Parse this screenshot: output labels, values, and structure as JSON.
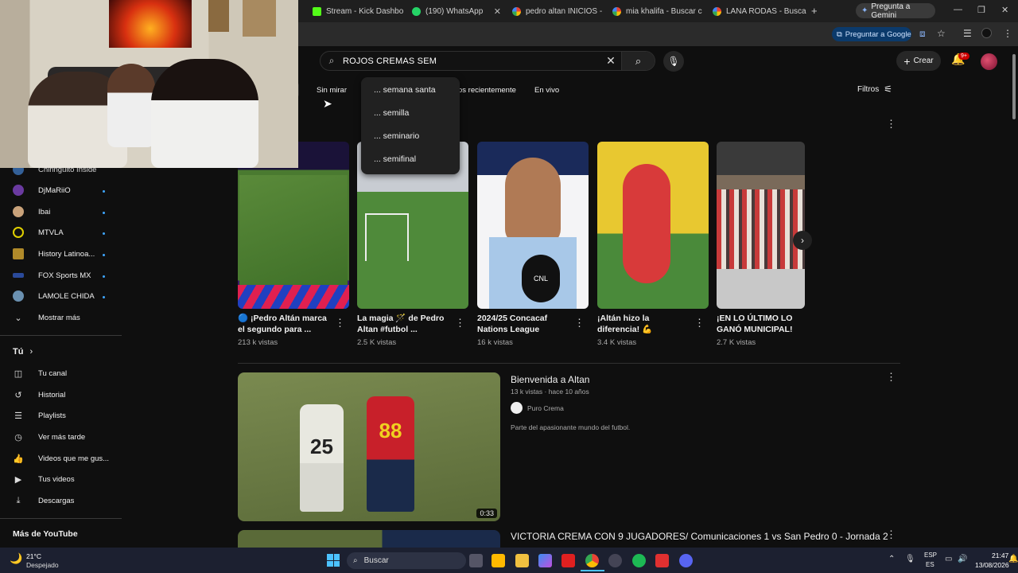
{
  "browser": {
    "tabs": [
      {
        "label": "Stream - Kick Dashbo",
        "color": "#53fc18"
      },
      {
        "label": "(190) WhatsApp",
        "color": "#25d366"
      },
      {
        "label": "pedro altan INICIOS -",
        "color": "#4285f4"
      },
      {
        "label": "mia khalifa - Buscar c",
        "color": "#4285f4"
      },
      {
        "label": "LANA RODAS - Buscar",
        "color": "#4285f4"
      }
    ],
    "new_tab": "+",
    "gemini_label": "Pregunta a Gemini",
    "ask_google_label": "Preguntar a Google"
  },
  "search": {
    "query": "ROJOS CREMAS SEM",
    "suggestions": [
      "... semana santa",
      "... semilla",
      "... seminario",
      "... semifinal"
    ]
  },
  "header": {
    "create_label": "Crear",
    "notifications_badge": "9+"
  },
  "chips": {
    "sin_mirar": "Sin mirar",
    "recent": "os recientemente",
    "live": "En vivo",
    "filters": "Filtros"
  },
  "sidebar": {
    "subscriptions": [
      {
        "label": "Chiringuito Inside",
        "color": "#3a6fb0"
      },
      {
        "label": "DjMaRiiO",
        "color": "#6a3aa0"
      },
      {
        "label": "Ibai",
        "color": "#c9a27a"
      },
      {
        "label": "MTVLA",
        "color": "#e0d000"
      },
      {
        "label": "History Latinoa...",
        "color": "#b08a2a"
      },
      {
        "label": "FOX Sports MX",
        "color": "#2a4a9a"
      },
      {
        "label": "LAMOLE CHIDA",
        "color": "#6a90b0"
      }
    ],
    "show_more": "Mostrar más",
    "you_label": "Tú",
    "you_items": [
      "Tu canal",
      "Historial",
      "Playlists",
      "Ver más tarde",
      "Videos que me gus...",
      "Tus videos",
      "Descargas"
    ],
    "more_label": "Más de YouTube"
  },
  "shorts": [
    {
      "title": "🔵 ¡Pedro Altán marca el segundo para ...",
      "views": "213 k vistas"
    },
    {
      "title": "La magia 🪄 de Pedro Altan #futbol ...",
      "views": "2.5 K vistas"
    },
    {
      "title": "2024/25 Concacaf Nations League Group...",
      "views": "16 k vistas"
    },
    {
      "title": "¡Altán hizo la diferencia! 💪",
      "views": "3.4 K vistas"
    },
    {
      "title": "¡EN LO ÚLTIMO LO GANÓ MUNICIPAL! 👀..",
      "views": "2.7 K vistas"
    }
  ],
  "videos": [
    {
      "title": "Bienvenida a Altan",
      "meta": "13 k vistas · hace 10 años",
      "channel": "Puro Crema",
      "description": "Parte del apasionante mundo del futbol.",
      "duration": "0:33",
      "jersey_left": "25",
      "jersey_right": "88"
    },
    {
      "title": "VICTORIA CREMA CON 9 JUGADORES/ Comunicaciones 1 vs San Pedro 0 - Jornada 2"
    }
  ],
  "taskbar": {
    "weather_temp": "21°C",
    "weather_desc": "Despejado",
    "search_label": "Buscar",
    "lang_top": "ESP",
    "lang_bottom": "ES",
    "time": "21:47",
    "date": "13/08/2026"
  }
}
